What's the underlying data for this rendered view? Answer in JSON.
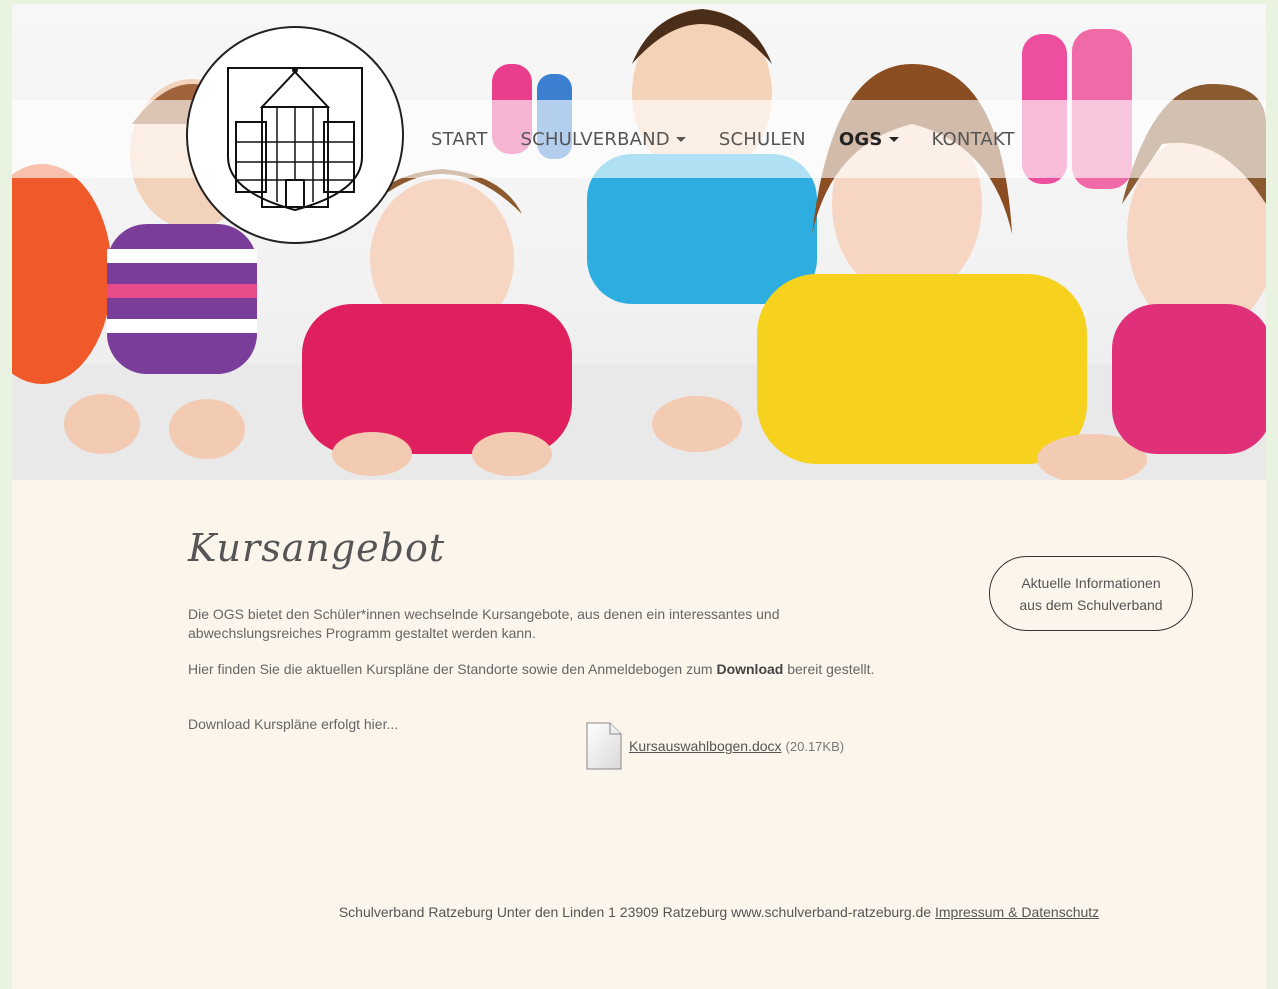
{
  "nav": {
    "items": [
      {
        "label": "START",
        "dropdown": false,
        "active": false
      },
      {
        "label": "SCHULVERBAND",
        "dropdown": true,
        "active": false
      },
      {
        "label": "SCHULEN",
        "dropdown": false,
        "active": false
      },
      {
        "label": "OGS",
        "dropdown": true,
        "active": true
      },
      {
        "label": "KONTAKT",
        "dropdown": false,
        "active": false
      }
    ]
  },
  "hero": {
    "image": "children-lying-on-floor-photo"
  },
  "logo": {
    "icon": "castle-coat-of-arms-icon"
  },
  "main": {
    "title": "Kursangebot",
    "intro": "Die OGS bietet den Schüler*innen wechselnde Kursangebote, aus denen ein interessantes und abwechslungsreiches Programm gestaltet werden kann.",
    "download_text_before": "Hier finden Sie die aktuellen Kurspläne der Standorte sowie den Anmeldebogen zum ",
    "download_bold": "Download",
    "download_text_after": " bereit gestellt.",
    "download_hint": "Download Kurspläne erfolgt hier...",
    "file": {
      "name": "Kursauswahlbogen.docx",
      "size": "(20.17KB)",
      "icon": "document-file-icon"
    }
  },
  "sidebar": {
    "button_label_line1": "Aktuelle Informationen",
    "button_label_line2": "aus dem Schulverband"
  },
  "footer": {
    "text": "Schulverband Ratzeburg Unter den Linden 1 23909 Ratzeburg www.schulverband-ratzeburg.de ",
    "link": "Impressum & Datenschutz"
  },
  "colors": {
    "background": "#fcf5ec",
    "outer": "#eaf2e0",
    "text": "#555555"
  }
}
